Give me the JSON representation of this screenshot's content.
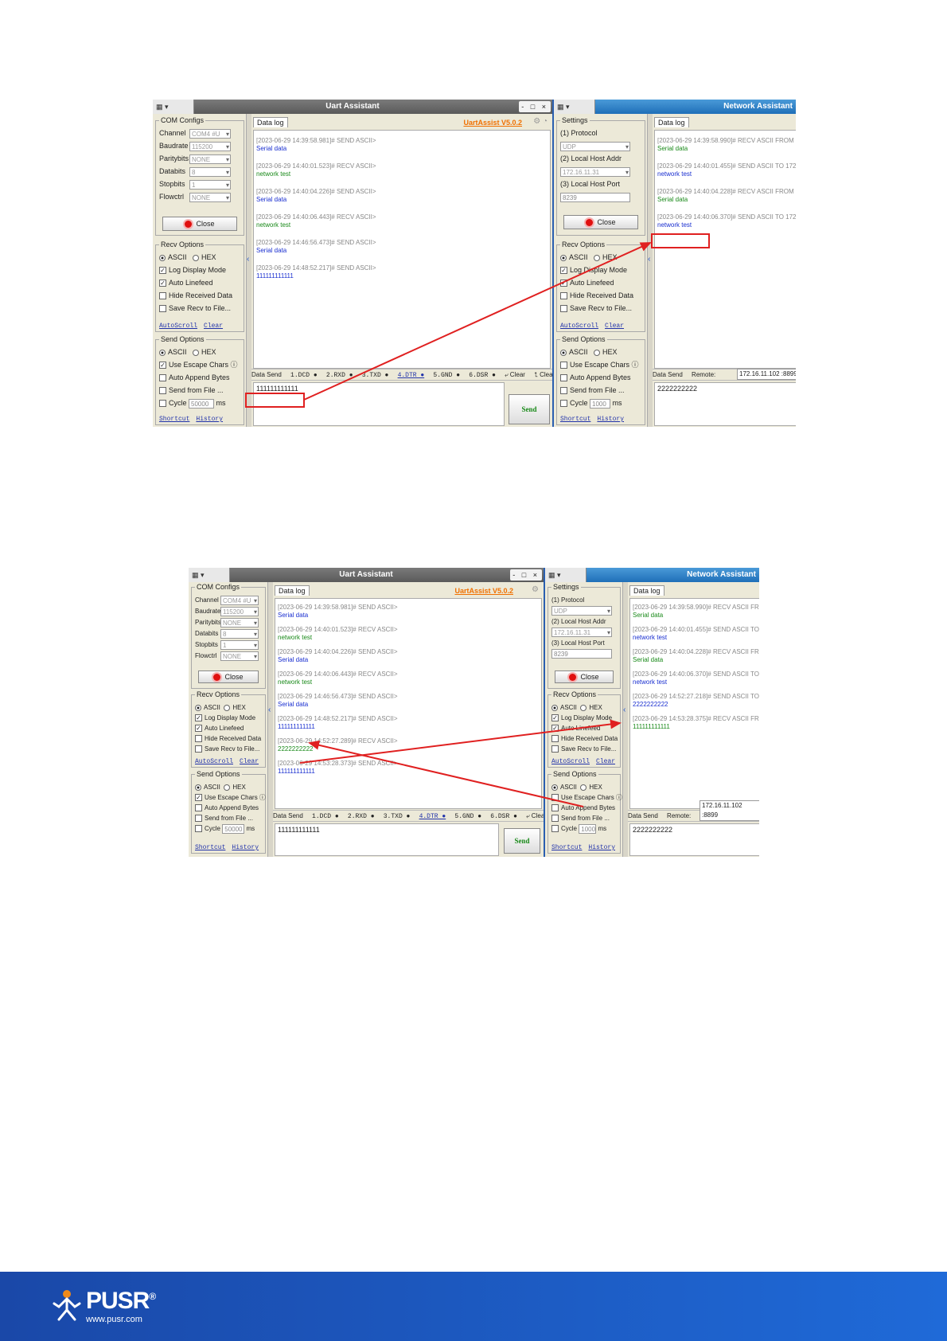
{
  "uart": {
    "menu": "▾",
    "title": "Uart Assistant",
    "version": "UartAssist V5.0.2",
    "window_controls": "- □ ×",
    "com_configs": {
      "legend": "COM Configs",
      "channel_label": "Channel",
      "channel": "COM4 #U",
      "baudrate_label": "Baudrate",
      "baudrate": "115200",
      "paritybits_label": "Paritybits",
      "paritybits": "NONE",
      "databits_label": "Databits",
      "databits": "8",
      "stopbits_label": "Stopbits",
      "stopbits": "1",
      "flowctrl_label": "Flowctrl",
      "flowctrl": "NONE",
      "close_label": "Close"
    },
    "recv_options": {
      "legend": "Recv Options",
      "ascii": "ASCII",
      "hex": "HEX",
      "log_display": "Log Display Mode",
      "auto_linefeed": "Auto Linefeed",
      "hide_received": "Hide Received Data",
      "save_recv": "Save Recv to File...",
      "autoscroll": "AutoScroll",
      "clear": "Clear"
    },
    "send_options": {
      "legend": "Send Options",
      "ascii": "ASCII",
      "hex": "HEX",
      "escape": "Use Escape Chars ⓘ",
      "append": "Auto Append Bytes",
      "from_file": "Send from File ...",
      "cycle": "Cycle",
      "cycle_value": "50000",
      "cycle_unit": "ms",
      "shortcut": "Shortcut",
      "history": "History"
    },
    "data_log_tab": "Data log",
    "send_bar": {
      "label": "Data Send",
      "dcd": "1.DCD ●",
      "rxd": "2.RXD ●",
      "txd": "3.TXD ●",
      "dtr": "4.DTR ●",
      "gnd": "5.GND ●",
      "dsr": "6.DSR ●",
      "clear1": "⤶ Clear",
      "clear2": "⮤ Clear"
    },
    "send_label": "Send",
    "log1": [
      {
        "ts": "[2023-06-29 14:39:58.981]# SEND ASCII>",
        "msg": "Serial data",
        "color": "blue"
      },
      {
        "ts": "[2023-06-29 14:40:01.523]# RECV ASCII>",
        "msg": "network test",
        "color": "green"
      },
      {
        "ts": "[2023-06-29 14:40:04.226]# SEND ASCII>",
        "msg": "Serial data",
        "color": "blue"
      },
      {
        "ts": "[2023-06-29 14:40:06.443]# RECV ASCII>",
        "msg": "network test",
        "color": "green"
      },
      {
        "ts": "[2023-06-29 14:46:56.473]# SEND ASCII>",
        "msg": "Serial data",
        "color": "blue"
      },
      {
        "ts": "[2023-06-29 14:48:52.217]# SEND ASCII>",
        "msg": "111111111111",
        "color": "blue"
      }
    ],
    "log2": [
      {
        "ts": "[2023-06-29 14:39:58.981]# SEND ASCII>",
        "msg": "Serial data",
        "color": "blue"
      },
      {
        "ts": "[2023-06-29 14:40:01.523]# RECV ASCII>",
        "msg": "network test",
        "color": "green"
      },
      {
        "ts": "[2023-06-29 14:40:04.226]# SEND ASCII>",
        "msg": "Serial data",
        "color": "blue"
      },
      {
        "ts": "[2023-06-29 14:40:06.443]# RECV ASCII>",
        "msg": "network test",
        "color": "green"
      },
      {
        "ts": "[2023-06-29 14:46:56.473]# SEND ASCII>",
        "msg": "Serial data",
        "color": "blue"
      },
      {
        "ts": "[2023-06-29 14:48:52.217]# SEND ASCII>",
        "msg": "111111111111",
        "color": "blue"
      },
      {
        "ts": "[2023-06-29 14:52:27.289]# RECV ASCII>",
        "msg": "2222222222",
        "color": "green"
      },
      {
        "ts": "[2023-06-29 14:53:28.373]# SEND ASCII>",
        "msg": "111111111111",
        "color": "blue"
      }
    ],
    "send_value": "111111111111"
  },
  "network": {
    "menu": "▾",
    "title": "Network Assistant",
    "settings": {
      "legend": "Settings",
      "protocol_label": "(1) Protocol",
      "protocol": "UDP",
      "host_addr_label": "(2) Local Host Addr",
      "host_addr": "172.16.11.31",
      "host_port_label": "(3) Local Host Port",
      "host_port": "8239",
      "close_label": "Close"
    },
    "recv_options": {
      "legend": "Recv Options",
      "ascii": "ASCII",
      "hex": "HEX",
      "log_display": "Log Display Mode",
      "auto_linefeed": "Auto Linefeed",
      "hide_received": "Hide Received Data",
      "save_recv": "Save Recv to File...",
      "autoscroll": "AutoScroll",
      "clear": "Clear"
    },
    "send_options": {
      "legend": "Send Options",
      "ascii": "ASCII",
      "hex": "HEX",
      "escape": "Use Escape Chars ⓘ",
      "append": "Auto Append Bytes",
      "from_file": "Send from File ...",
      "cycle": "Cycle",
      "cycle_value": "1000",
      "cycle_unit": "ms",
      "shortcut": "Shortcut",
      "history": "History"
    },
    "data_log_tab": "Data log",
    "data_send_label": "Data Send",
    "remote_label": "Remote:",
    "remote_value": "172.16.11.102 :8899",
    "remote_value_2": "172.16.11.102 :8899",
    "log1": [
      {
        "ts": "[2023-06-29 14:39:58.990]# RECV ASCII FROM 1",
        "msg": "Serial data",
        "color": "green"
      },
      {
        "ts": "[2023-06-29 14:40:01.455]# SEND ASCII TO 172",
        "msg": "network test",
        "color": "blue"
      },
      {
        "ts": "[2023-06-29 14:40:04.228]# RECV ASCII FROM 1",
        "msg": "Serial data",
        "color": "green"
      },
      {
        "ts": "[2023-06-29 14:40:06.370]# SEND ASCII TO 172",
        "msg": "network test",
        "color": "blue"
      }
    ],
    "log2": [
      {
        "ts": "[2023-06-29 14:39:58.990]# RECV ASCII FROM 172",
        "msg": "Serial data",
        "color": "green"
      },
      {
        "ts": "[2023-06-29 14:40:01.455]# SEND ASCII TO 172.16",
        "msg": "network test",
        "color": "blue"
      },
      {
        "ts": "[2023-06-29 14:40:04.228]# RECV ASCII FROM 172",
        "msg": "Serial data",
        "color": "green"
      },
      {
        "ts": "[2023-06-29 14:40:06.370]# SEND ASCII TO 172.16",
        "msg": "network test",
        "color": "blue"
      },
      {
        "ts": "[2023-06-29 14:52:27.218]# SEND ASCII TO 172.16",
        "msg": "2222222222",
        "color": "blue"
      },
      {
        "ts": "[2023-06-29 14:53:28.375]# RECV ASCII FROM 172",
        "msg": "111111111111",
        "color": "green"
      }
    ],
    "send_value": "2222222222"
  },
  "footer": {
    "brand": "PUSR",
    "registered": "®",
    "url": "www.pusr.com"
  },
  "colors": {
    "highlight": "#e02020",
    "footer": "#1f5fc8"
  }
}
